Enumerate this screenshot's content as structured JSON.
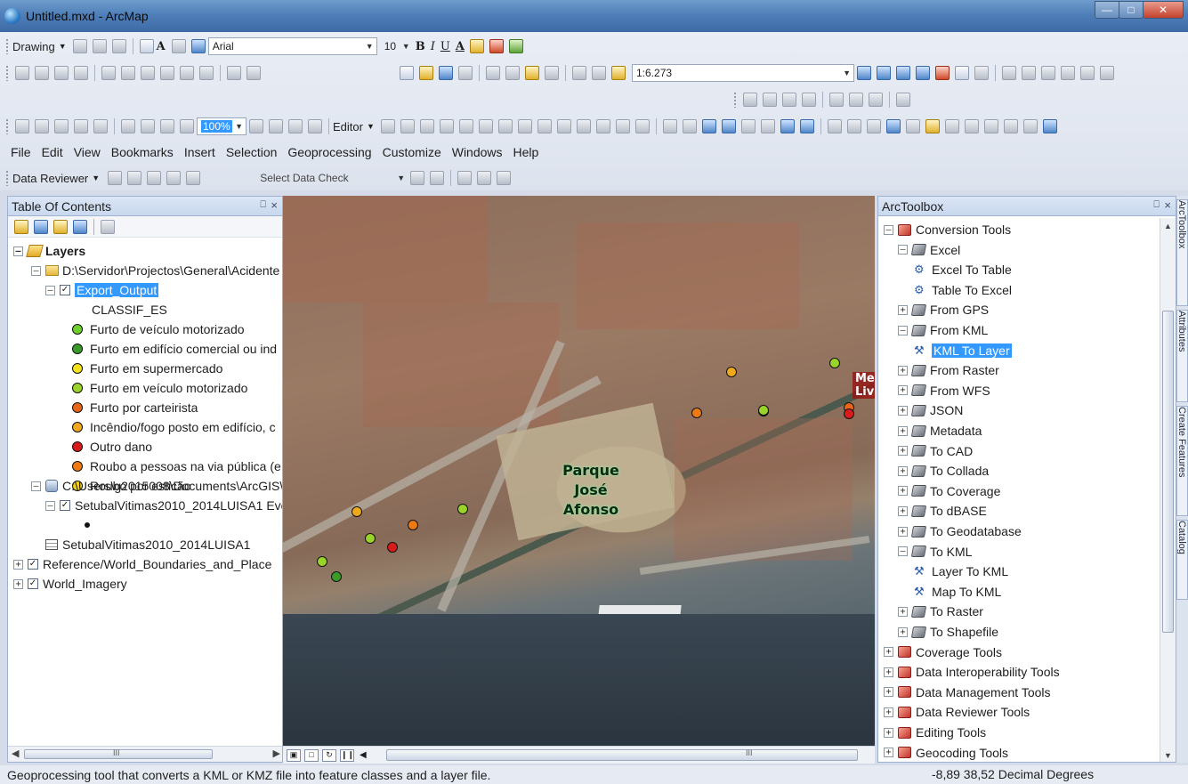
{
  "window": {
    "title": "Untitled.mxd - ArcMap"
  },
  "toolbars": {
    "drawing_label": "Drawing",
    "font_name": "Arial",
    "font_size": "10",
    "bold": "B",
    "italic": "I",
    "underline": "U",
    "text_color_glyph": "A",
    "scale": "1:6.273",
    "zoom_percent": "100%",
    "editor_label": "Editor",
    "data_reviewer_label": "Data Reviewer",
    "select_data_check": "Select Data Check"
  },
  "menu": [
    "File",
    "Edit",
    "View",
    "Bookmarks",
    "Insert",
    "Selection",
    "Geoprocessing",
    "Customize",
    "Windows",
    "Help"
  ],
  "toc": {
    "title": "Table Of Contents",
    "pin_glyph": "⎕",
    "close_glyph": "×",
    "layers_root": "Layers",
    "folder1": "D:\\Servidor\\Projectos\\General\\Acidente",
    "export_layer": "Export_Output",
    "field": "CLASSIF_ES",
    "classes": [
      {
        "label": "Furto de veículo motorizado",
        "color": "#6fcf2e"
      },
      {
        "label": "Furto em edifício comercial ou ind",
        "color": "#3a9a2a"
      },
      {
        "label": "Furto em supermercado",
        "color": "#f2e21c"
      },
      {
        "label": "Furto em veículo motorizado",
        "color": "#9ad42a"
      },
      {
        "label": "Furto por carteirista",
        "color": "#e8661a"
      },
      {
        "label": "Incêndio/fogo posto em edifício, c",
        "color": "#f0a91c"
      },
      {
        "label": "Outro dano",
        "color": "#d81c1c"
      },
      {
        "label": "Roubo a pessoas na via pública (e:",
        "color": "#ee7a14"
      },
      {
        "label": "Roubo por esticão",
        "color": "#f6d21a"
      }
    ],
    "folder2": "C:\\Users\\g2015008\\Documents\\ArcGIS\\",
    "events_layer": "SetubalVitimas2010_2014LUISA1 Eve",
    "table": "SetubalVitimas2010_2014LUISA1",
    "reference_layer": "Reference/World_Boundaries_and_Place",
    "imagery_layer": "World_Imagery",
    "scroll_mark": "III"
  },
  "map": {
    "label_park_1": "Parque",
    "label_park_2": "José",
    "label_park_3": "Afonso",
    "label_me": "Me\nLiv",
    "points_colors": [
      "#f0a91c",
      "#9ad42a",
      "#ee7a14",
      "#e8661a",
      "#d81c1c"
    ],
    "scroll_mark": "III"
  },
  "toolbox": {
    "title": "ArcToolbox",
    "items": [
      {
        "label": "Conversion Tools",
        "kind": "toolbox",
        "expanded": true,
        "indent": 0
      },
      {
        "label": "Excel",
        "kind": "toolset",
        "expanded": true,
        "indent": 1
      },
      {
        "label": "Excel To Table",
        "kind": "tool",
        "indent": 2
      },
      {
        "label": "Table To Excel",
        "kind": "tool",
        "indent": 2
      },
      {
        "label": "From GPS",
        "kind": "toolset",
        "expanded": false,
        "indent": 1
      },
      {
        "label": "From KML",
        "kind": "toolset",
        "expanded": true,
        "indent": 1
      },
      {
        "label": "KML To Layer",
        "kind": "tool-hammer",
        "indent": 2,
        "selected": true
      },
      {
        "label": "From Raster",
        "kind": "toolset",
        "expanded": false,
        "indent": 1
      },
      {
        "label": "From WFS",
        "kind": "toolset",
        "expanded": false,
        "indent": 1
      },
      {
        "label": "JSON",
        "kind": "toolset",
        "expanded": false,
        "indent": 1
      },
      {
        "label": "Metadata",
        "kind": "toolset",
        "expanded": false,
        "indent": 1
      },
      {
        "label": "To CAD",
        "kind": "toolset",
        "expanded": false,
        "indent": 1
      },
      {
        "label": "To Collada",
        "kind": "toolset",
        "expanded": false,
        "indent": 1
      },
      {
        "label": "To Coverage",
        "kind": "toolset",
        "expanded": false,
        "indent": 1
      },
      {
        "label": "To dBASE",
        "kind": "toolset",
        "expanded": false,
        "indent": 1
      },
      {
        "label": "To Geodatabase",
        "kind": "toolset",
        "expanded": false,
        "indent": 1
      },
      {
        "label": "To KML",
        "kind": "toolset",
        "expanded": true,
        "indent": 1
      },
      {
        "label": "Layer To KML",
        "kind": "tool-hammer",
        "indent": 2
      },
      {
        "label": "Map To KML",
        "kind": "tool-hammer",
        "indent": 2
      },
      {
        "label": "To Raster",
        "kind": "toolset",
        "expanded": false,
        "indent": 1
      },
      {
        "label": "To Shapefile",
        "kind": "toolset",
        "expanded": false,
        "indent": 1
      },
      {
        "label": "Coverage Tools",
        "kind": "toolbox",
        "expanded": false,
        "indent": 0
      },
      {
        "label": "Data Interoperability Tools",
        "kind": "toolbox",
        "expanded": false,
        "indent": 0
      },
      {
        "label": "Data Management Tools",
        "kind": "toolbox",
        "expanded": false,
        "indent": 0
      },
      {
        "label": "Data Reviewer Tools",
        "kind": "toolbox",
        "expanded": false,
        "indent": 0
      },
      {
        "label": "Editing Tools",
        "kind": "toolbox",
        "expanded": false,
        "indent": 0
      },
      {
        "label": "Geocoding Tools",
        "kind": "toolbox",
        "expanded": false,
        "indent": 0
      }
    ]
  },
  "side_tabs": [
    "ArcToolbox",
    "Attributes",
    "Create Features",
    "Catalog"
  ],
  "status": {
    "message": "Geoprocessing tool that converts a KML or KMZ file into feature classes and a layer file.",
    "coordinates": "-8,89  38,52 Decimal Degrees"
  }
}
